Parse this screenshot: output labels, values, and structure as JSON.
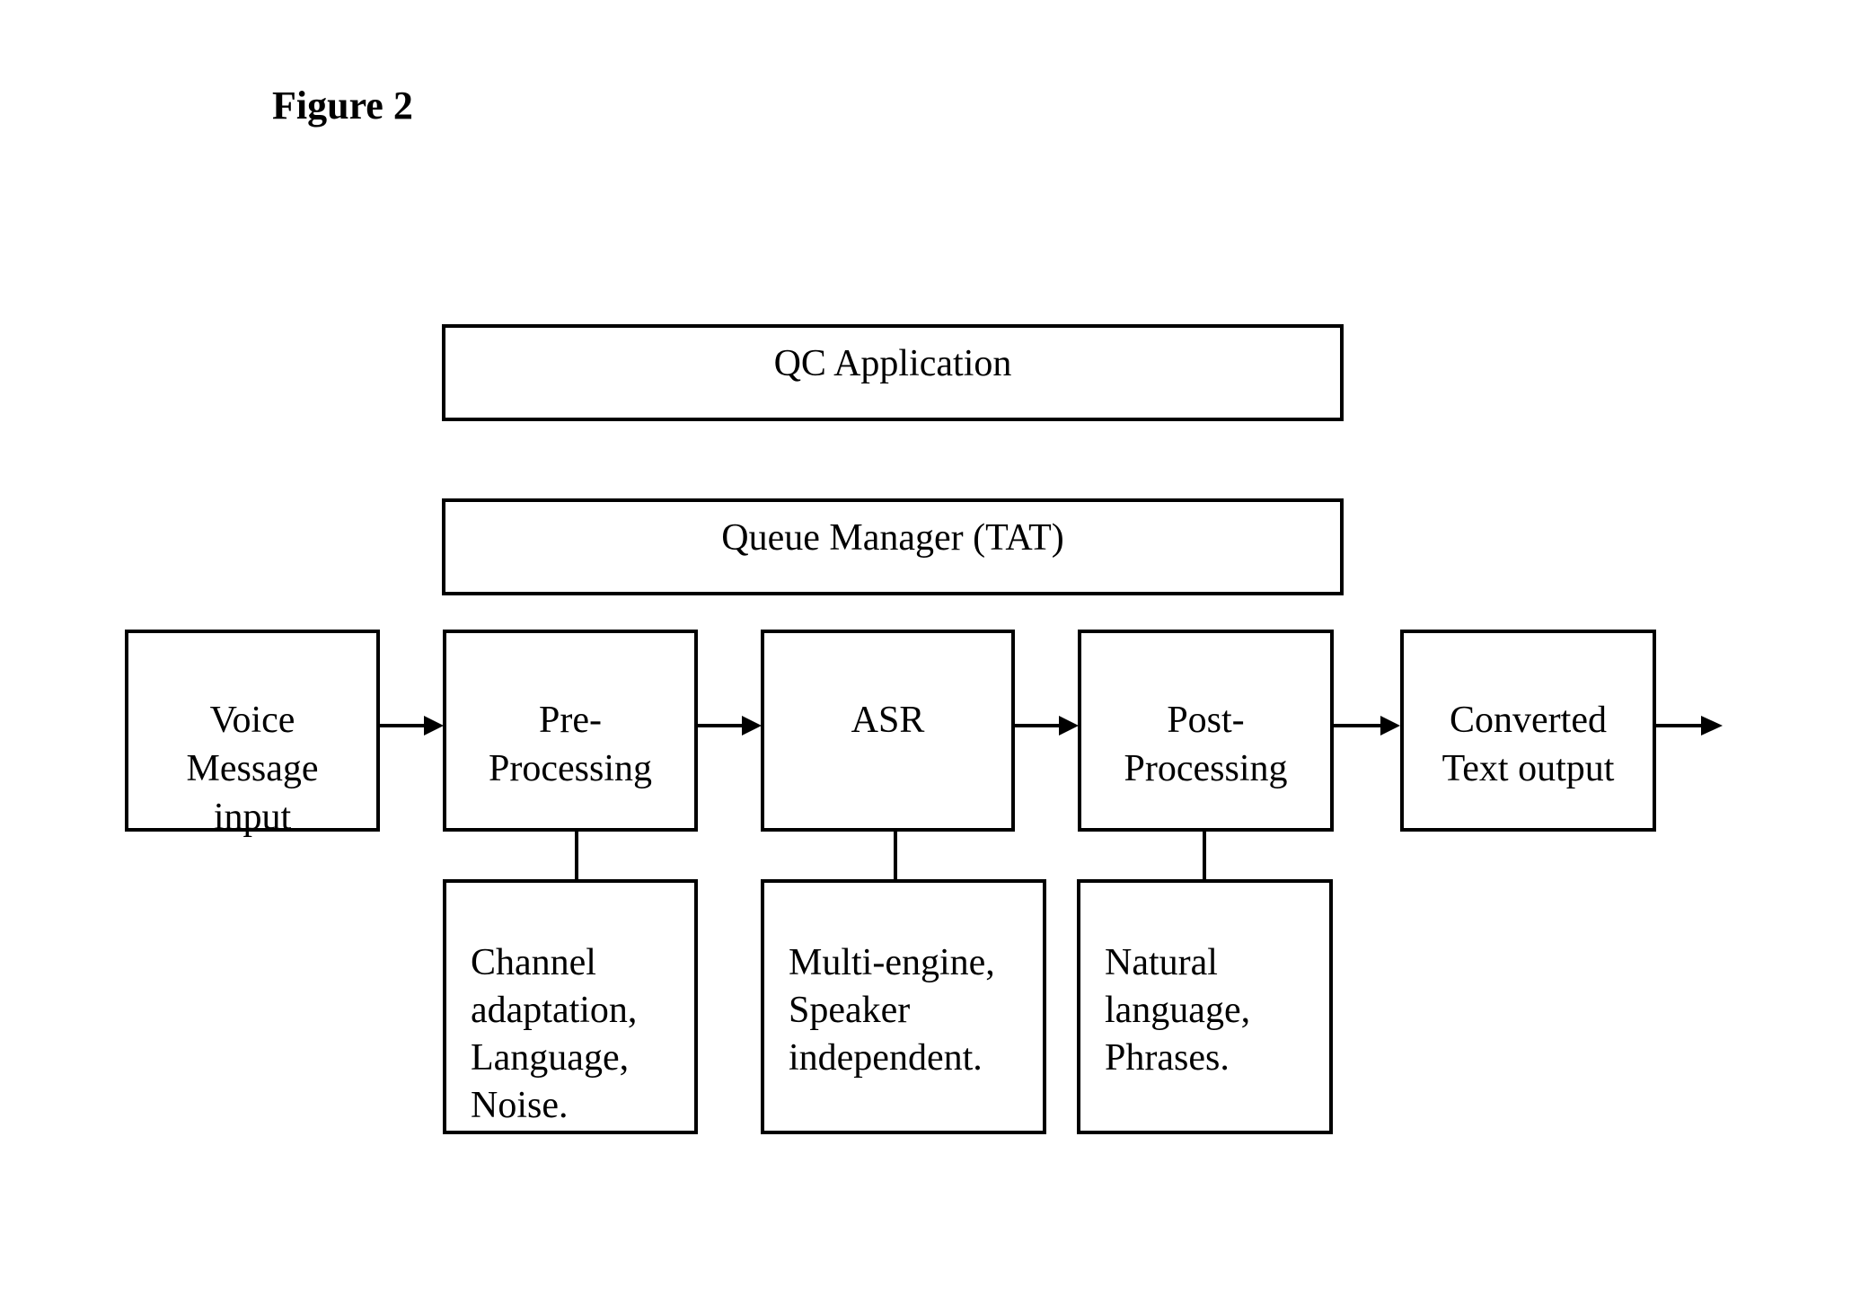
{
  "figure_title": "Figure 2",
  "top_boxes": {
    "qc": "QC Application",
    "queue": "Queue Manager (TAT)"
  },
  "pipeline": [
    {
      "id": "voice",
      "label": "Voice\nMessage\ninput"
    },
    {
      "id": "pre",
      "label": "Pre-\nProcessing"
    },
    {
      "id": "asr",
      "label": "ASR"
    },
    {
      "id": "post",
      "label": "Post-\nProcessing"
    },
    {
      "id": "output",
      "label": "Converted\nText output"
    }
  ],
  "details": [
    {
      "attached_to": "pre",
      "text": "Channel\nadaptation,\nLanguage,\nNoise."
    },
    {
      "attached_to": "asr",
      "text": "Multi-engine,\nSpeaker\nindependent."
    },
    {
      "attached_to": "post",
      "text": "Natural\nlanguage,\nPhrases."
    }
  ],
  "connections": [
    {
      "from": "voice",
      "to": "pre",
      "type": "arrow"
    },
    {
      "from": "pre",
      "to": "asr",
      "type": "arrow"
    },
    {
      "from": "asr",
      "to": "post",
      "type": "arrow"
    },
    {
      "from": "post",
      "to": "output",
      "type": "arrow"
    },
    {
      "from": "output",
      "to": "external",
      "type": "arrow"
    },
    {
      "from": "pre",
      "to": "detail-pre",
      "type": "line"
    },
    {
      "from": "asr",
      "to": "detail-asr",
      "type": "line"
    },
    {
      "from": "post",
      "to": "detail-post",
      "type": "line"
    }
  ]
}
